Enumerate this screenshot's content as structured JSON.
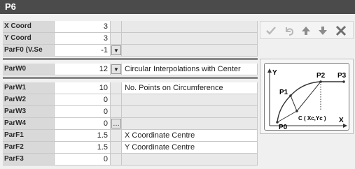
{
  "window": {
    "title": "P6"
  },
  "params": [
    {
      "name": "X Coord",
      "value": "3",
      "description": ""
    },
    {
      "name": "Y Coord",
      "value": "3",
      "description": ""
    },
    {
      "name": "ParF0 (V.Se",
      "value": "-1",
      "description": "",
      "control": "dropdown"
    },
    {
      "name": "ParW0",
      "value": "12",
      "description": "Circular Interpolations with Center",
      "control": "dropdown"
    },
    {
      "name": "ParW1",
      "value": "10",
      "description": "No. Points on Circumference"
    },
    {
      "name": "ParW2",
      "value": "0",
      "description": ""
    },
    {
      "name": "ParW3",
      "value": "0",
      "description": ""
    },
    {
      "name": "ParW4",
      "value": "0",
      "description": "",
      "control": "ellipsis"
    },
    {
      "name": "ParF1",
      "value": "1.5",
      "description": "X Coordinate Centre"
    },
    {
      "name": "ParF2",
      "value": "1.5",
      "description": "Y Coordinate Centre"
    },
    {
      "name": "ParF3",
      "value": "0",
      "description": ""
    }
  ],
  "toolbar": {
    "icons": [
      "checkmark-icon",
      "undo-icon",
      "move-up-icon",
      "move-down-icon",
      "delete-icon"
    ]
  },
  "diagram": {
    "y_axis": "Y",
    "x_axis": "X",
    "p0": "P0",
    "p1": "P1",
    "p2": "P2",
    "p3": "P3",
    "center": "C ( Xc,Yc )"
  }
}
